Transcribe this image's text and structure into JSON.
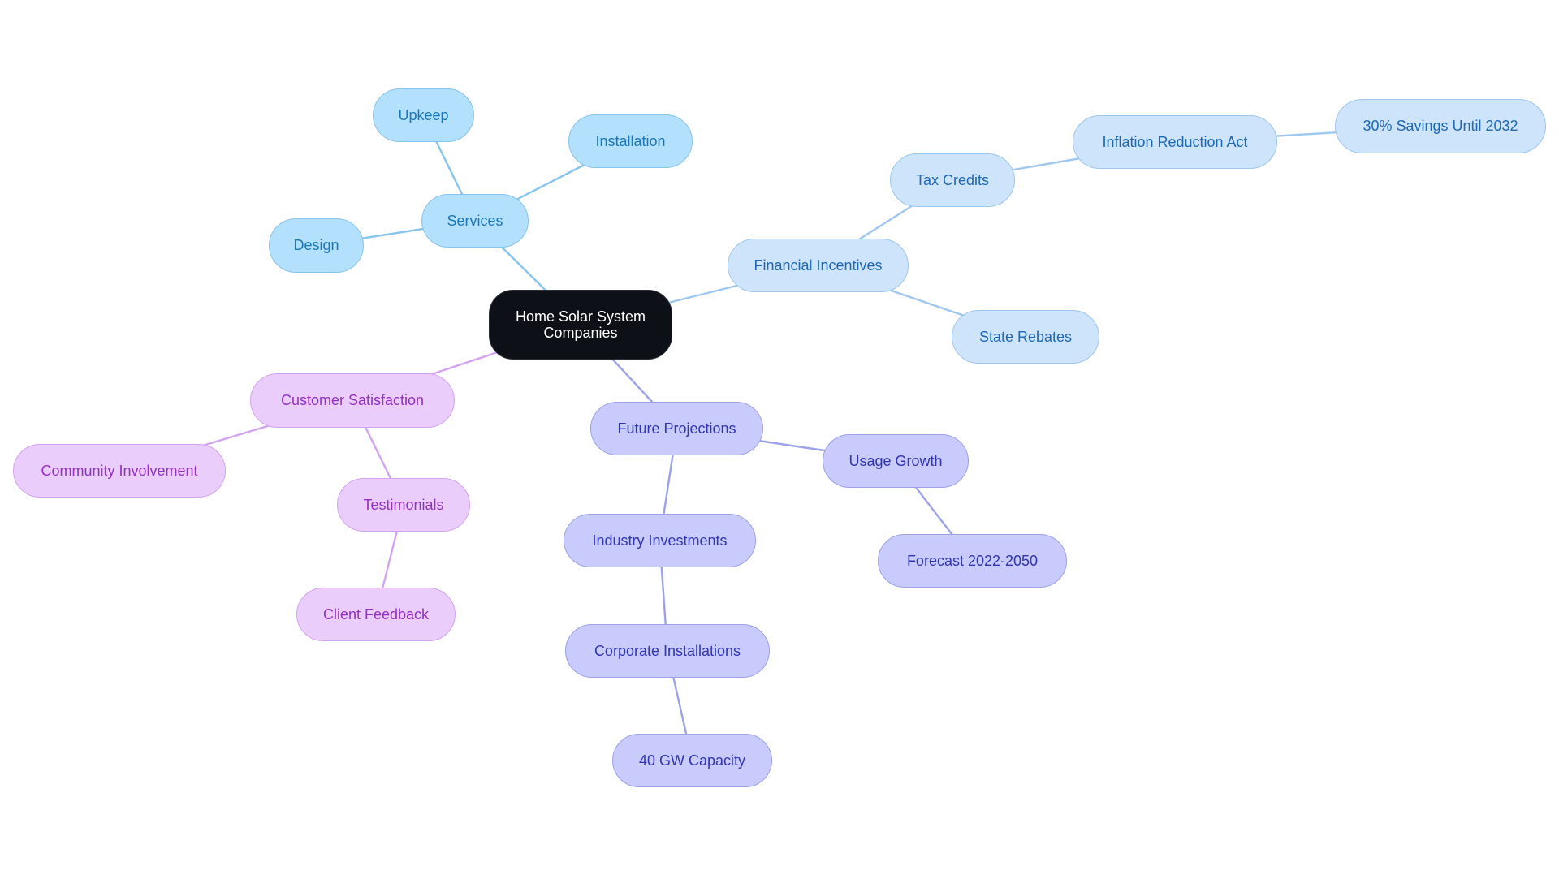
{
  "diagram": {
    "type": "mindmap",
    "root": {
      "id": "root",
      "label": "Home Solar System Companies"
    },
    "colors": {
      "root_fill": "#0d1117",
      "root_text": "#ffffff",
      "services": {
        "fill": "#b3e0fd",
        "text": "#1a78b8",
        "edge": "#86c4ec"
      },
      "financial": {
        "fill": "#cde4fb",
        "text": "#1e68b4",
        "edge": "#9ec6ee"
      },
      "customer": {
        "fill": "#ebcdfc",
        "text": "#9430c4",
        "edge": "#d3a3ef"
      },
      "future": {
        "fill": "#c8cbfc",
        "text": "#3236b0",
        "edge": "#9da1e8"
      }
    },
    "nodes": [
      {
        "id": "root",
        "label": "Home Solar System Companies",
        "branch": "root"
      },
      {
        "id": "services",
        "label": "Services",
        "branch": "services",
        "parent": "root"
      },
      {
        "id": "upkeep",
        "label": "Upkeep",
        "branch": "services",
        "parent": "services"
      },
      {
        "id": "installation",
        "label": "Installation",
        "branch": "services",
        "parent": "services"
      },
      {
        "id": "design",
        "label": "Design",
        "branch": "services",
        "parent": "services"
      },
      {
        "id": "financial",
        "label": "Financial Incentives",
        "branch": "financial",
        "parent": "root"
      },
      {
        "id": "tax",
        "label": "Tax Credits",
        "branch": "financial",
        "parent": "financial"
      },
      {
        "id": "ira",
        "label": "Inflation Reduction Act",
        "branch": "financial",
        "parent": "tax"
      },
      {
        "id": "savings",
        "label": "30% Savings Until 2032",
        "branch": "financial",
        "parent": "ira"
      },
      {
        "id": "rebates",
        "label": "State Rebates",
        "branch": "financial",
        "parent": "financial"
      },
      {
        "id": "customer",
        "label": "Customer Satisfaction",
        "branch": "customer",
        "parent": "root"
      },
      {
        "id": "community",
        "label": "Community Involvement",
        "branch": "customer",
        "parent": "customer"
      },
      {
        "id": "testimonials",
        "label": "Testimonials",
        "branch": "customer",
        "parent": "customer"
      },
      {
        "id": "feedback",
        "label": "Client Feedback",
        "branch": "customer",
        "parent": "testimonials"
      },
      {
        "id": "future",
        "label": "Future Projections",
        "branch": "future",
        "parent": "root"
      },
      {
        "id": "usage",
        "label": "Usage Growth",
        "branch": "future",
        "parent": "future"
      },
      {
        "id": "forecast",
        "label": "Forecast 2022-2050",
        "branch": "future",
        "parent": "usage"
      },
      {
        "id": "industry",
        "label": "Industry Investments",
        "branch": "future",
        "parent": "future"
      },
      {
        "id": "corporate",
        "label": "Corporate Installations",
        "branch": "future",
        "parent": "industry"
      },
      {
        "id": "capacity",
        "label": "40 GW Capacity",
        "branch": "future",
        "parent": "corporate"
      }
    ]
  }
}
